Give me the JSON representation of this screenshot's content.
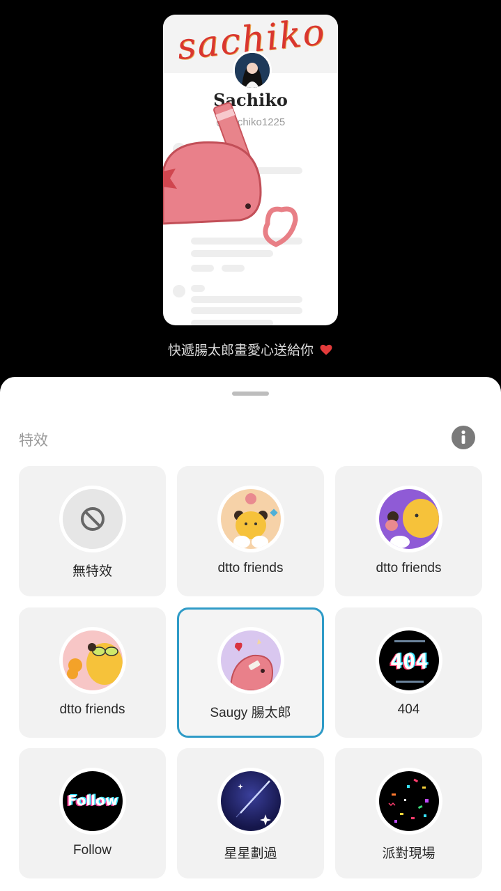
{
  "preview": {
    "banner_signature": "sachiko",
    "profile_name": "Sachiko",
    "profile_handle": "@sachiko1225",
    "caption": "快遞腸太郎畫愛心送給你"
  },
  "sheet": {
    "title": "特效",
    "info_icon": "info-icon",
    "effects": [
      {
        "label": "無特效",
        "icon": "no-effect-icon",
        "selected": false
      },
      {
        "label": "dtto friends",
        "icon": "dtto-friends-peach-thumbnail",
        "selected": false
      },
      {
        "label": "dtto friends",
        "icon": "dtto-friends-purple-thumbnail",
        "selected": false
      },
      {
        "label": "dtto friends",
        "icon": "dtto-friends-pink-thumbnail",
        "selected": false
      },
      {
        "label": "Saugy 腸太郎",
        "icon": "saugy-thumbnail",
        "selected": true
      },
      {
        "label": "404",
        "icon": "glitch-404-thumbnail",
        "selected": false,
        "thumb_text": "404"
      },
      {
        "label": "Follow",
        "icon": "follow-thumbnail",
        "selected": false,
        "thumb_text": "Follow"
      },
      {
        "label": "星星劃過",
        "icon": "shooting-star-thumbnail",
        "selected": false
      },
      {
        "label": "派對現場",
        "icon": "party-confetti-thumbnail",
        "selected": false
      }
    ]
  },
  "colors": {
    "selected_border": "#2f9bc7",
    "tile_bg": "#f2f2f2",
    "signature_red": "#d9362f",
    "sticker_pink": "#e87f86"
  }
}
